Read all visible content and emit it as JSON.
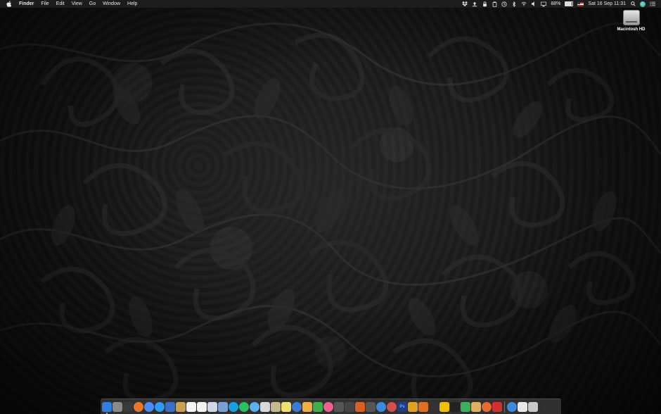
{
  "menubar": {
    "app_name": "Finder",
    "menus": [
      "File",
      "Edit",
      "View",
      "Go",
      "Window",
      "Help"
    ],
    "battery_percent": "88%",
    "date_time": "Sat 16 Sep  11:31",
    "status_icons": [
      "dropbox-icon",
      "upload-icon",
      "lock-icon",
      "clipboard-icon",
      "time-machine-icon",
      "bluetooth-icon",
      "wifi-icon",
      "volume-icon",
      "airplay-icon",
      "battery-icon",
      "flag-icon",
      "search-icon",
      "siri-icon",
      "notification-center-icon"
    ]
  },
  "desktop": {
    "icons": [
      {
        "label": "Macintosh HD",
        "icon": "hard-drive-icon"
      }
    ]
  },
  "dock": {
    "apps": [
      {
        "name": "finder",
        "color": "#2f7fe0"
      },
      {
        "name": "launchpad",
        "color": "#8a8a8a"
      },
      {
        "name": "mission-control",
        "color": "#3a3a3a"
      },
      {
        "name": "firefox",
        "color": "#e8772a"
      },
      {
        "name": "chrome",
        "color": "#4c8bf5"
      },
      {
        "name": "safari",
        "color": "#2d9bf0"
      },
      {
        "name": "preview",
        "color": "#3a6ec8"
      },
      {
        "name": "notebook",
        "color": "#c8a050"
      },
      {
        "name": "notes",
        "color": "#f4f4f4"
      },
      {
        "name": "calendar",
        "color": "#f2f2f2"
      },
      {
        "name": "photos",
        "color": "#d0d8e8"
      },
      {
        "name": "reminders",
        "color": "#7aa0d8"
      },
      {
        "name": "skype",
        "color": "#19a0e0"
      },
      {
        "name": "whatsapp",
        "color": "#2dbe60"
      },
      {
        "name": "messages",
        "color": "#5ab0f0"
      },
      {
        "name": "mail",
        "color": "#d8d8d8"
      },
      {
        "name": "contacts",
        "color": "#c8b890"
      },
      {
        "name": "stickies",
        "color": "#f0e070"
      },
      {
        "name": "1password",
        "color": "#3c7ad8"
      },
      {
        "name": "pages",
        "color": "#f0b040"
      },
      {
        "name": "numbers",
        "color": "#3cb04c"
      },
      {
        "name": "itunes",
        "color": "#f06090"
      },
      {
        "name": "video-editor",
        "color": "#555555"
      },
      {
        "name": "activity-monitor",
        "color": "#444444"
      },
      {
        "name": "transmit",
        "color": "#d86020"
      },
      {
        "name": "omnifocus",
        "color": "#555555"
      },
      {
        "name": "privacy",
        "color": "#3c8ae0"
      },
      {
        "name": "app-store",
        "color": "#d05050"
      },
      {
        "name": "photoshop",
        "color": "#1f3c88",
        "label": "Ps"
      },
      {
        "name": "pencil",
        "color": "#e0a020"
      },
      {
        "name": "sublime",
        "color": "#e07020"
      },
      {
        "name": "code-editor",
        "color": "#333333"
      },
      {
        "name": "cyberduck",
        "color": "#f0c000"
      },
      {
        "name": "terminal",
        "color": "#222222"
      },
      {
        "name": "android-studio",
        "color": "#3cae5c"
      },
      {
        "name": "burger",
        "color": "#e0b060"
      },
      {
        "name": "sketch",
        "color": "#e86a30"
      },
      {
        "name": "remote",
        "color": "#d03030"
      }
    ],
    "trailing": [
      {
        "name": "downloads",
        "color": "#3a8ae0"
      },
      {
        "name": "documents",
        "color": "#e8e8e8"
      },
      {
        "name": "trash",
        "color": "#c8c8c8"
      }
    ]
  }
}
